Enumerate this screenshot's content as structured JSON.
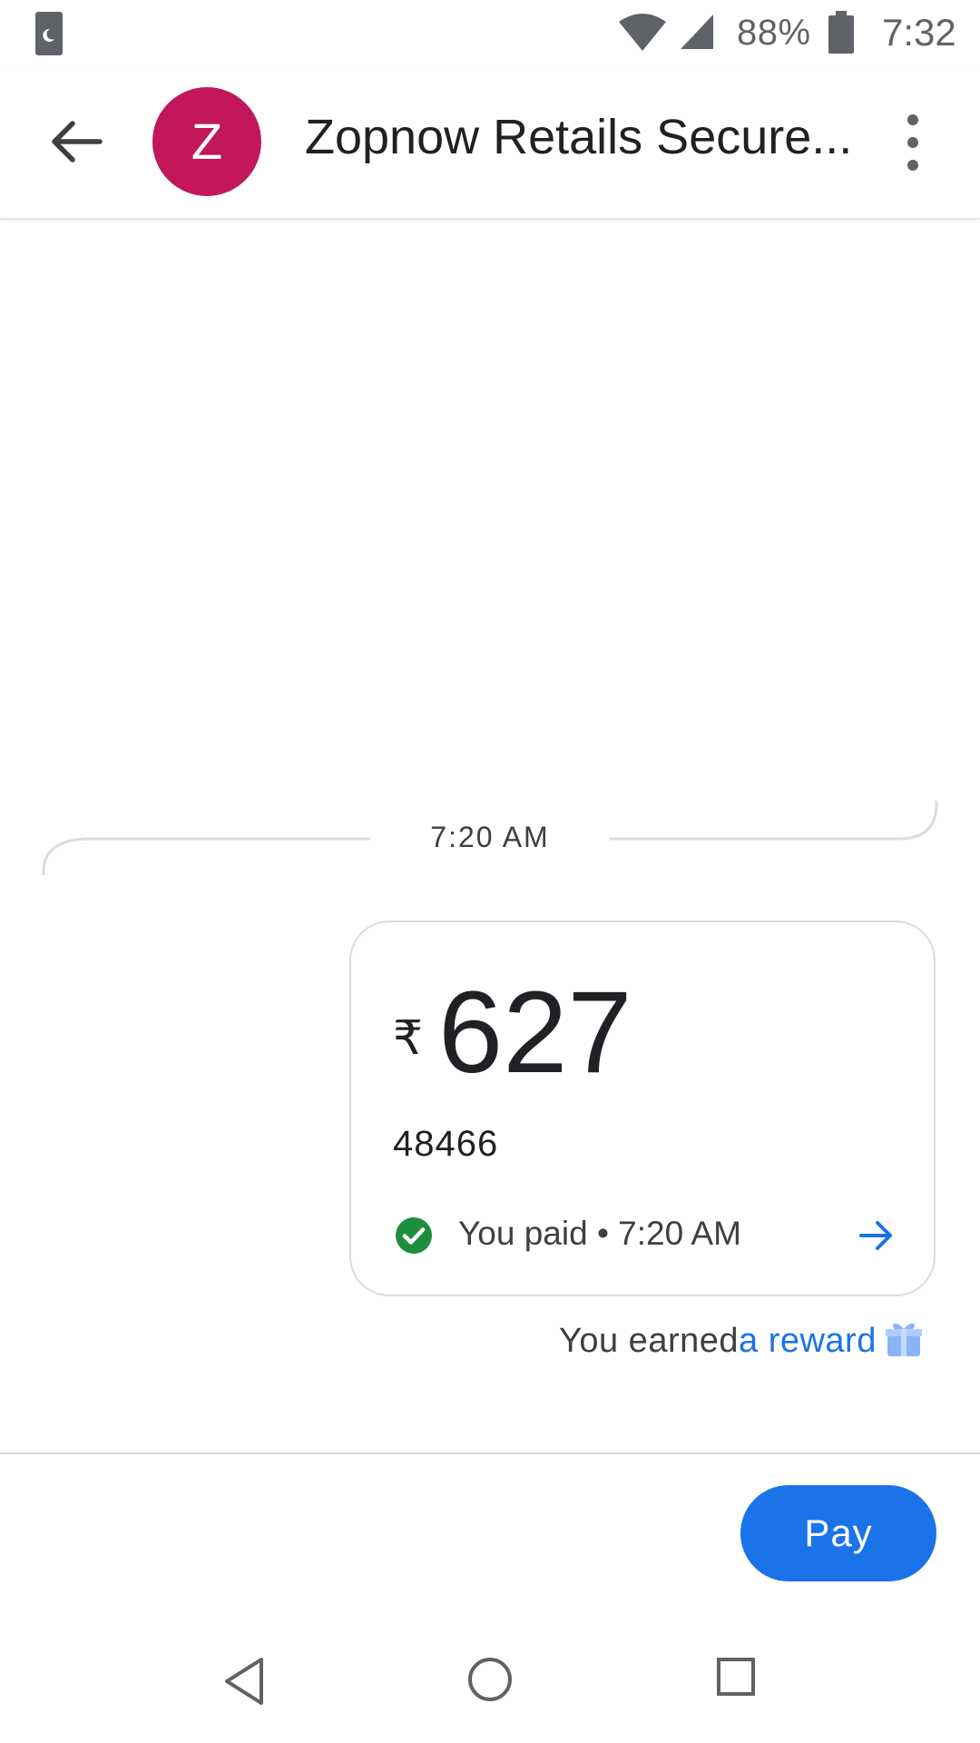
{
  "status_bar": {
    "battery_percent": "88%",
    "time": "7:32",
    "icons": [
      "do-not-disturb-icon",
      "wifi-icon",
      "signal-icon",
      "battery-icon"
    ]
  },
  "app_bar": {
    "avatar_letter": "Z",
    "avatar_color": "#c2185b",
    "title": "Zopnow Retails Secure..."
  },
  "conversation": {
    "timestamp": "7:20 AM",
    "payment": {
      "currency_symbol": "₹",
      "amount": "627",
      "note": "48466",
      "status_text": "You paid • 7:20 AM",
      "status_color": "#1e8e3e"
    },
    "reward": {
      "prefix": "You earned",
      "link_text": "a reward"
    }
  },
  "actions": {
    "pay_label": "Pay",
    "accent_color": "#1a73e8"
  }
}
